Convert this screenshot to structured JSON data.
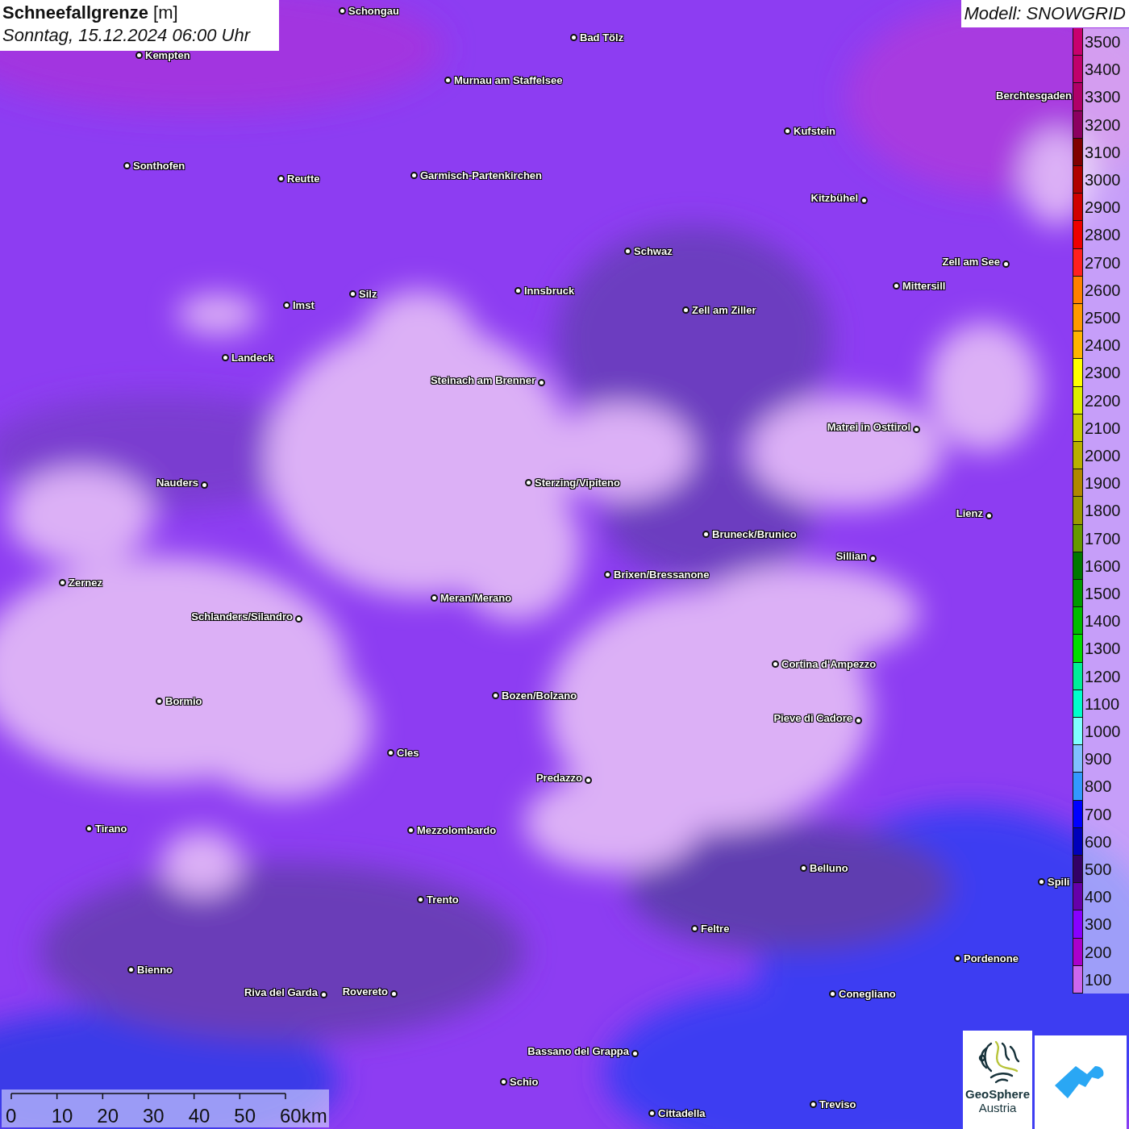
{
  "title": {
    "heading": "**Schneefallgrenze** [m]",
    "subtitle": "Sonntag, 15.12.2024 06:00 Uhr"
  },
  "model": "Modell: SNOWGRID",
  "legend": [
    {
      "label": "3500",
      "color": "#c8006e"
    },
    {
      "label": "3400",
      "color": "#c0006c"
    },
    {
      "label": "3300",
      "color": "#b00068"
    },
    {
      "label": "3200",
      "color": "#8c0060"
    },
    {
      "label": "3100",
      "color": "#800000"
    },
    {
      "label": "3000",
      "color": "#b00000"
    },
    {
      "label": "2900",
      "color": "#d00000"
    },
    {
      "label": "2800",
      "color": "#ee0000"
    },
    {
      "label": "2700",
      "color": "#ff2020"
    },
    {
      "label": "2600",
      "color": "#ff8000"
    },
    {
      "label": "2500",
      "color": "#ff9900"
    },
    {
      "label": "2400",
      "color": "#ffb400"
    },
    {
      "label": "2300",
      "color": "#ffff00"
    },
    {
      "label": "2200",
      "color": "#ddee00"
    },
    {
      "label": "2100",
      "color": "#c8cc00"
    },
    {
      "label": "2000",
      "color": "#b8b000"
    },
    {
      "label": "1900",
      "color": "#b08800"
    },
    {
      "label": "1800",
      "color": "#9a9a00"
    },
    {
      "label": "1700",
      "color": "#669900"
    },
    {
      "label": "1600",
      "color": "#007700"
    },
    {
      "label": "1500",
      "color": "#009900"
    },
    {
      "label": "1400",
      "color": "#00bb00"
    },
    {
      "label": "1300",
      "color": "#00dd00"
    },
    {
      "label": "1200",
      "color": "#00ee99"
    },
    {
      "label": "1100",
      "color": "#00ffcc"
    },
    {
      "label": "1000",
      "color": "#80ffff"
    },
    {
      "label": "900",
      "color": "#80c0ff"
    },
    {
      "label": "800",
      "color": "#3399ff"
    },
    {
      "label": "700",
      "color": "#0000ff"
    },
    {
      "label": "600",
      "color": "#0000bb"
    },
    {
      "label": "500",
      "color": "#330066"
    },
    {
      "label": "400",
      "color": "#6600aa"
    },
    {
      "label": "300",
      "color": "#8800ff"
    },
    {
      "label": "200",
      "color": "#aa00cc"
    },
    {
      "label": "100",
      "color": "#cc66ee"
    }
  ],
  "cities": [
    {
      "name": "Schongau"
    },
    {
      "name": "Bad Tölz"
    },
    {
      "name": "Kempten"
    },
    {
      "name": "Murnau am Staffelsee"
    },
    {
      "name": "Berchtesgaden"
    },
    {
      "name": "Kufstein"
    },
    {
      "name": "Sonthofen"
    },
    {
      "name": "Reutte"
    },
    {
      "name": "Garmisch-Partenkirchen"
    },
    {
      "name": "Kitzbühel"
    },
    {
      "name": "Schwaz"
    },
    {
      "name": "Zell am See"
    },
    {
      "name": "Mittersill"
    },
    {
      "name": "Innsbruck"
    },
    {
      "name": "Silz"
    },
    {
      "name": "Imst"
    },
    {
      "name": "Zell am Ziller"
    },
    {
      "name": "Landeck"
    },
    {
      "name": "Steinach am Brenner"
    },
    {
      "name": "Matrei in Osttirol"
    },
    {
      "name": "Nauders"
    },
    {
      "name": "Sterzing/Vipiteno"
    },
    {
      "name": "Lienz"
    },
    {
      "name": "Bruneck/Brunico"
    },
    {
      "name": "Sillian"
    },
    {
      "name": "Brixen/Bressanone"
    },
    {
      "name": "Zernez"
    },
    {
      "name": "Meran/Merano"
    },
    {
      "name": "Schlanders/Silandro"
    },
    {
      "name": "Cortina d'Ampezzo"
    },
    {
      "name": "Bozen/Bolzano"
    },
    {
      "name": "Bormio"
    },
    {
      "name": "Pieve di Cadore"
    },
    {
      "name": "Cles"
    },
    {
      "name": "Predazzo"
    },
    {
      "name": "Tirano"
    },
    {
      "name": "Mezzolombardo"
    },
    {
      "name": "Belluno"
    },
    {
      "name": "Spili"
    },
    {
      "name": "Trento"
    },
    {
      "name": "Feltre"
    },
    {
      "name": "Pordenone"
    },
    {
      "name": "Bienno"
    },
    {
      "name": "Riva del Garda"
    },
    {
      "name": "Rovereto"
    },
    {
      "name": "Conegliano"
    },
    {
      "name": "Bassano del Grappa"
    },
    {
      "name": "Schio"
    },
    {
      "name": "Treviso"
    },
    {
      "name": "Cittadella"
    }
  ],
  "scale_bar": {
    "ticks": [
      "0",
      "10",
      "20",
      "30",
      "40",
      "50",
      "60km"
    ]
  },
  "logo": {
    "name": "GeoSphere",
    "subtitle": "Austria"
  }
}
